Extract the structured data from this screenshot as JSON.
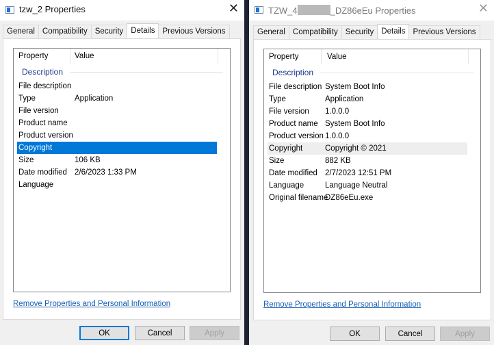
{
  "tabs": [
    "General",
    "Compatibility",
    "Security",
    "Details",
    "Previous Versions"
  ],
  "columns": {
    "property": "Property",
    "value": "Value"
  },
  "group": "Description",
  "link": "Remove Properties and Personal Information",
  "buttons": {
    "ok": "OK",
    "cancel": "Cancel",
    "apply": "Apply"
  },
  "left": {
    "title": "tzw_2 Properties",
    "rows": [
      {
        "k": "File description",
        "v": ""
      },
      {
        "k": "Type",
        "v": "Application"
      },
      {
        "k": "File version",
        "v": ""
      },
      {
        "k": "Product name",
        "v": ""
      },
      {
        "k": "Product version",
        "v": ""
      },
      {
        "k": "Copyright",
        "v": ""
      },
      {
        "k": "Size",
        "v": "106 KB"
      },
      {
        "k": "Date modified",
        "v": "2/6/2023 1:33 PM"
      },
      {
        "k": "Language",
        "v": ""
      }
    ]
  },
  "right": {
    "title_prefix": "TZW_4",
    "title_suffix": "_DZ86eEu Properties",
    "rows": [
      {
        "k": "File description",
        "v": "System Boot Info"
      },
      {
        "k": "Type",
        "v": "Application"
      },
      {
        "k": "File version",
        "v": "1.0.0.0"
      },
      {
        "k": "Product name",
        "v": "System Boot Info"
      },
      {
        "k": "Product version",
        "v": "1.0.0.0"
      },
      {
        "k": "Copyright",
        "v": "Copyright ©  2021"
      },
      {
        "k": "Size",
        "v": "882 KB"
      },
      {
        "k": "Date modified",
        "v": "2/7/2023 12:51 PM"
      },
      {
        "k": "Language",
        "v": "Language Neutral"
      },
      {
        "k": "Original filename",
        "v": "DZ86eEu.exe"
      }
    ]
  }
}
